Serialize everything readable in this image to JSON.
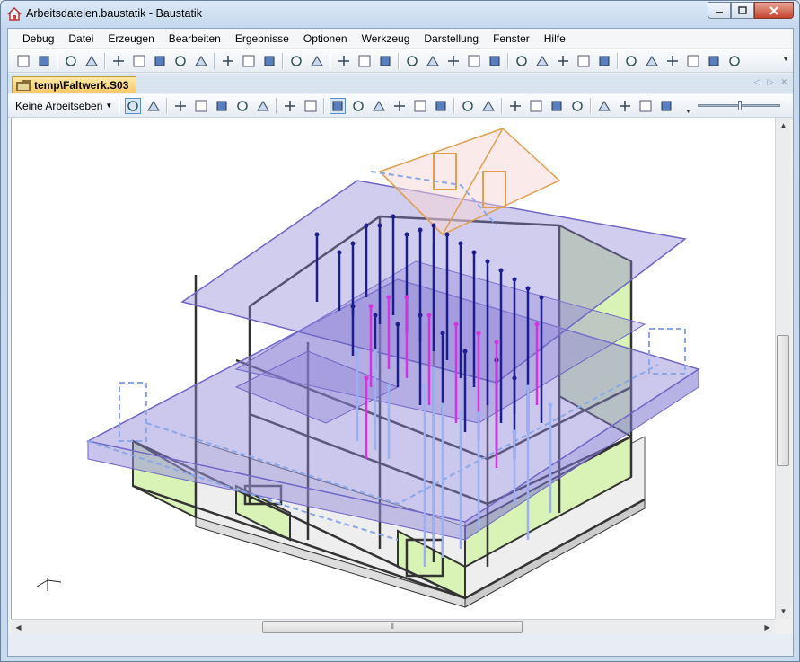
{
  "window": {
    "title": "Arbeitsdateien.baustatik - Baustatik",
    "minimize_icon": "minimize-icon",
    "maximize_icon": "maximize-icon",
    "close_icon": "close-icon"
  },
  "menu": {
    "items": [
      "Debug",
      "Datei",
      "Erzeugen",
      "Bearbeiten",
      "Ergebnisse",
      "Optionen",
      "Werkzeug",
      "Darstellung",
      "Fenster",
      "Hilfe"
    ]
  },
  "toolbar": {
    "icons": [
      "new-doc-icon",
      "copy-docs-icon",
      "save-icon",
      "page-icon",
      "print-preview-icon",
      "zoom-page-icon",
      "print-icon",
      "pdf-icon",
      "export-icon",
      "lasso-icon",
      "delete-icon",
      "copy-icon",
      "undo-icon",
      "redo-icon",
      "building-icon",
      "cube-icon",
      "transfer-icon",
      "sphere-icon",
      "wedge-icon",
      "truss-icon",
      "load-icon",
      "rotate-load-icon",
      "view-icon",
      "beam-icon",
      "plate-icon",
      "panel-icon",
      "layers-icon",
      "stairs-icon",
      "measure-icon",
      "section-icon",
      "wall-icon",
      "frame-icon",
      "pen-icon"
    ]
  },
  "tabs": {
    "active_label": "temp\\Faltwerk.S03"
  },
  "toolbar2": {
    "workplane_label": "Keine Arbeitseben",
    "icons": [
      "pointer-icon",
      "rotate-select-icon",
      "zoom-window-icon",
      "zoom-icon",
      "pan-icon",
      "zoom-in-icon",
      "zoom-out-icon",
      "back-icon",
      "forward-icon",
      "house-solid-icon",
      "wall-frame-icon",
      "house-outline-icon",
      "house-detail-icon",
      "orbit-icon",
      "grid-icon",
      "camera-icon",
      "link-icon",
      "hatch-icon",
      "filter-icon",
      "select-area-icon",
      "snap-icon",
      "frame-view-icon",
      "roof-view-icon",
      "elevation-icon",
      "section-view-icon"
    ]
  },
  "colors": {
    "accent_tab": "#f8c866",
    "plate_fill": "#8b82d6",
    "load_dark": "#1b1e8c",
    "load_magenta": "#d633e0",
    "wall_green": "#d9f2b5",
    "roof_orange": "#e0a050"
  }
}
